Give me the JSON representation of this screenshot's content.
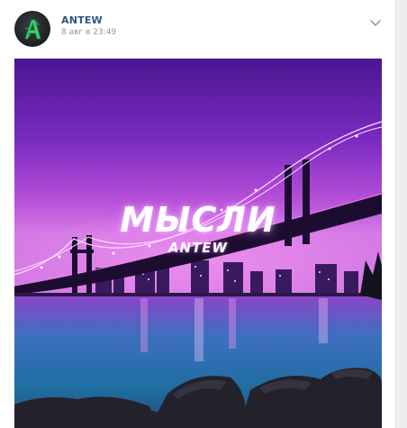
{
  "post": {
    "author": "ANTEW",
    "date": "8 авг в 23:49",
    "avatar_letter": "A",
    "avatar_color": "#39d36b",
    "menu_icon": "chevron-down-icon",
    "accent_color": "#2a5885"
  },
  "cover": {
    "title": "МЫСЛИ",
    "artist": "ANTEW",
    "sky_color": "#7a2bc0",
    "water_color": "#1e6ea0"
  }
}
